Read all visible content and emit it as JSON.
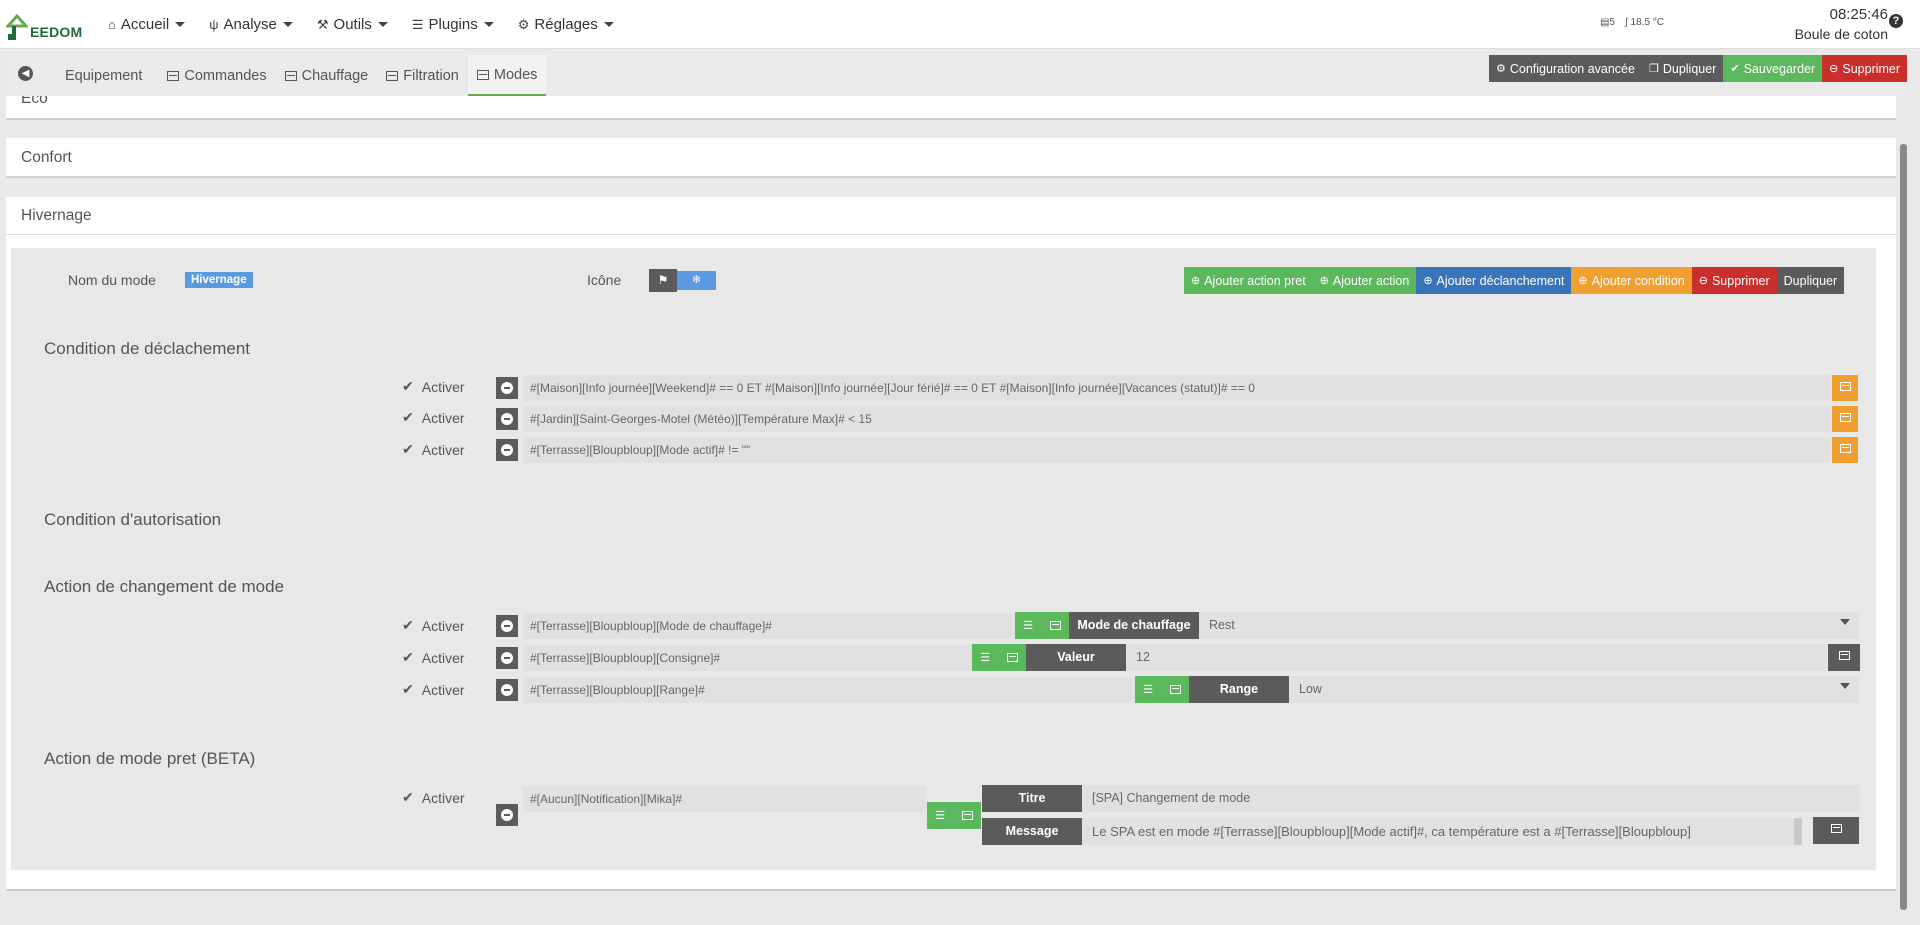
{
  "brand": {
    "name": "EEDOM"
  },
  "nav": {
    "items": [
      {
        "label": "Accueil",
        "icon": "home-icon"
      },
      {
        "label": "Analyse",
        "icon": "stethoscope-icon"
      },
      {
        "label": "Outils",
        "icon": "wrench-icon"
      },
      {
        "label": "Plugins",
        "icon": "tasks-icon"
      },
      {
        "label": "Réglages",
        "icon": "cogs-icon"
      }
    ]
  },
  "status": {
    "widget1": "5",
    "temperature": "18.5 °C",
    "time": "08:25:46",
    "name": "Boule de coton"
  },
  "tabs": [
    {
      "label": "Equipement"
    },
    {
      "label": "Commandes"
    },
    {
      "label": "Chauffage"
    },
    {
      "label": "Filtration"
    },
    {
      "label": "Modes"
    }
  ],
  "top_buttons": {
    "config": "Configuration avancée",
    "duplicate": "Dupliquer",
    "save": "Sauvegarder",
    "delete": "Supprimer"
  },
  "panels": {
    "eco": "Eco",
    "confort": "Confort",
    "hivernage": "Hivernage"
  },
  "mode": {
    "name_label": "Nom du mode",
    "name_value": "Hivernage",
    "icon_label": "Icône",
    "buttons": {
      "add_action_pret": "Ajouter action pret",
      "add_action": "Ajouter action",
      "add_trigger": "Ajouter déclanchement",
      "add_condition": "Ajouter condition",
      "delete": "Supprimer",
      "duplicate": "Dupliquer"
    }
  },
  "sections": {
    "trigger": "Condition de déclachement",
    "auth": "Condition d'autorisation",
    "change": "Action de changement de mode",
    "pret": "Action de mode pret (BETA)"
  },
  "activer": "Activer",
  "triggers": [
    "#[Maison][Info journée][Weekend]# == 0 ET #[Maison][Info journée][Jour férié]# == 0  ET #[Maison][Info journée][Vacances (statut)]# == 0",
    "#[Jardin][Saint-Georges-Motel (Météo)][Température Max]# < 15",
    "#[Terrasse][Bloupbloup][Mode actif]# != \"\""
  ],
  "actions": [
    {
      "cmd": "#[Terrasse][Bloupbloup][Mode de chauffage]#",
      "label": "Mode de chauffage",
      "value": "Rest"
    },
    {
      "cmd": "#[Terrasse][Bloupbloup][Consigne]#",
      "label": "Valeur",
      "value": "12"
    },
    {
      "cmd": "#[Terrasse][Bloupbloup][Range]#",
      "label": "Range",
      "value": "Low"
    }
  ],
  "pret": {
    "cmd": "#[Aucun][Notification][Mika]#",
    "title_label": "Titre",
    "title_value": "[SPA] Changement de mode",
    "message_label": "Message",
    "message_value": "Le SPA est en mode #[Terrasse][Bloupbloup][Mode actif]#, ca température est a  #[Terrasse][Bloupbloup]"
  },
  "colors": {
    "green": "#5cb85c",
    "red": "#c9302c",
    "blue": "#3a74b8",
    "orange": "#f0a030",
    "dark": "#5b5b5b",
    "badge": "#5b9ae0"
  }
}
